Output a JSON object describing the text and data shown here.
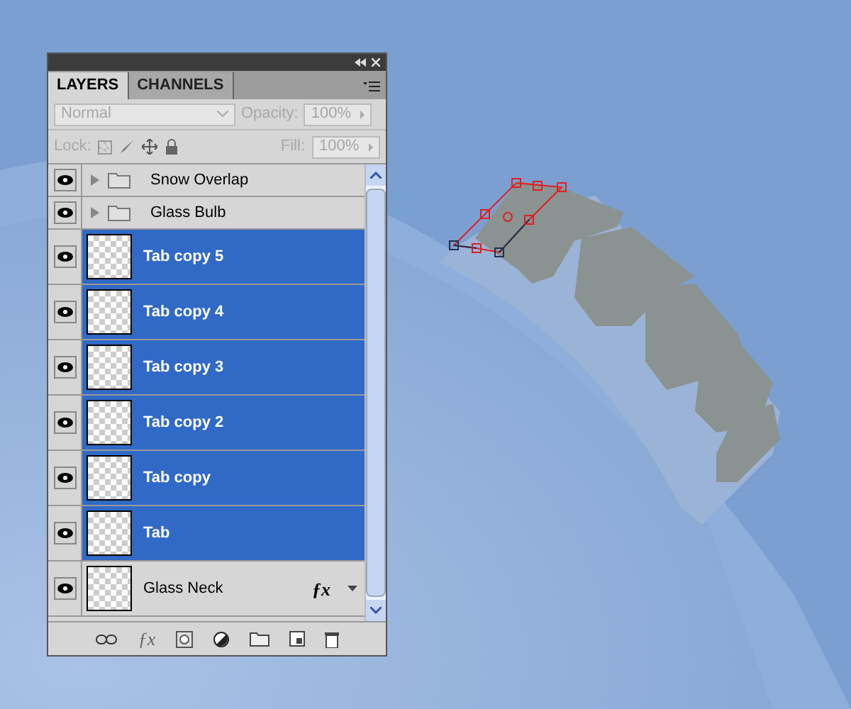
{
  "panel": {
    "tabs": [
      {
        "label": "LAYERS",
        "selected": true
      },
      {
        "label": "CHANNELS",
        "selected": false
      }
    ],
    "blend_mode": {
      "value": "Normal",
      "disabled": true
    },
    "opacity": {
      "label": "Opacity:",
      "value": "100%",
      "disabled": true
    },
    "lock": {
      "label": "Lock:",
      "disabled": true
    },
    "fill": {
      "label": "Fill:",
      "value": "100%",
      "disabled": true
    },
    "layers": [
      {
        "kind": "group",
        "name": "Snow Overlap",
        "visible": true,
        "selected": false,
        "expanded": false
      },
      {
        "kind": "group",
        "name": "Glass Bulb",
        "visible": true,
        "selected": false,
        "expanded": false
      },
      {
        "kind": "layer",
        "name": "Tab copy 5",
        "visible": true,
        "selected": true
      },
      {
        "kind": "layer",
        "name": "Tab copy 4",
        "visible": true,
        "selected": true
      },
      {
        "kind": "layer",
        "name": "Tab copy 3",
        "visible": true,
        "selected": true
      },
      {
        "kind": "layer",
        "name": "Tab copy 2",
        "visible": true,
        "selected": true
      },
      {
        "kind": "layer",
        "name": "Tab copy",
        "visible": true,
        "selected": true
      },
      {
        "kind": "layer",
        "name": "Tab",
        "visible": true,
        "selected": true
      },
      {
        "kind": "layer",
        "name": "Glass Neck",
        "visible": true,
        "selected": false,
        "fx": "ƒx"
      }
    ],
    "footer_fx": "ƒx"
  }
}
